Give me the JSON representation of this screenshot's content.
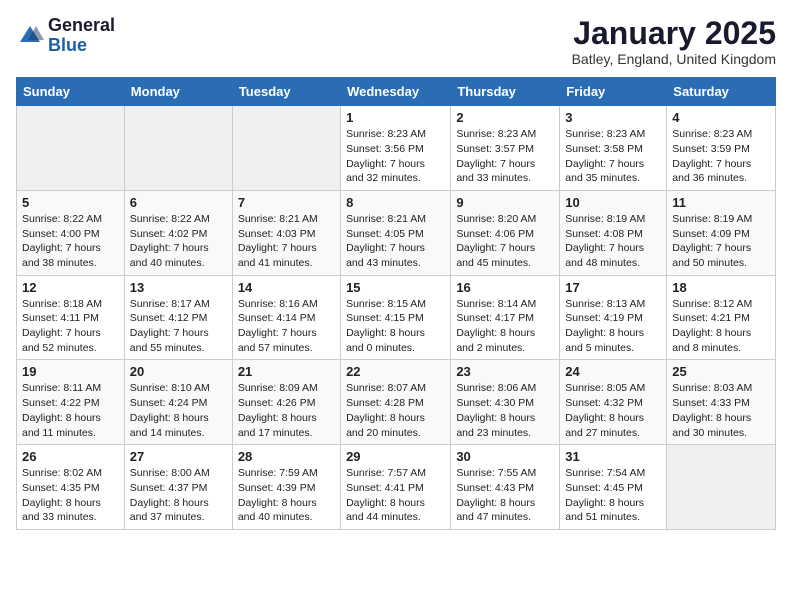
{
  "header": {
    "logo_general": "General",
    "logo_blue": "Blue",
    "title": "January 2025",
    "location": "Batley, England, United Kingdom"
  },
  "calendar": {
    "days_of_week": [
      "Sunday",
      "Monday",
      "Tuesday",
      "Wednesday",
      "Thursday",
      "Friday",
      "Saturday"
    ],
    "weeks": [
      [
        {
          "day": "",
          "info": ""
        },
        {
          "day": "",
          "info": ""
        },
        {
          "day": "",
          "info": ""
        },
        {
          "day": "1",
          "info": "Sunrise: 8:23 AM\nSunset: 3:56 PM\nDaylight: 7 hours\nand 32 minutes."
        },
        {
          "day": "2",
          "info": "Sunrise: 8:23 AM\nSunset: 3:57 PM\nDaylight: 7 hours\nand 33 minutes."
        },
        {
          "day": "3",
          "info": "Sunrise: 8:23 AM\nSunset: 3:58 PM\nDaylight: 7 hours\nand 35 minutes."
        },
        {
          "day": "4",
          "info": "Sunrise: 8:23 AM\nSunset: 3:59 PM\nDaylight: 7 hours\nand 36 minutes."
        }
      ],
      [
        {
          "day": "5",
          "info": "Sunrise: 8:22 AM\nSunset: 4:00 PM\nDaylight: 7 hours\nand 38 minutes."
        },
        {
          "day": "6",
          "info": "Sunrise: 8:22 AM\nSunset: 4:02 PM\nDaylight: 7 hours\nand 40 minutes."
        },
        {
          "day": "7",
          "info": "Sunrise: 8:21 AM\nSunset: 4:03 PM\nDaylight: 7 hours\nand 41 minutes."
        },
        {
          "day": "8",
          "info": "Sunrise: 8:21 AM\nSunset: 4:05 PM\nDaylight: 7 hours\nand 43 minutes."
        },
        {
          "day": "9",
          "info": "Sunrise: 8:20 AM\nSunset: 4:06 PM\nDaylight: 7 hours\nand 45 minutes."
        },
        {
          "day": "10",
          "info": "Sunrise: 8:19 AM\nSunset: 4:08 PM\nDaylight: 7 hours\nand 48 minutes."
        },
        {
          "day": "11",
          "info": "Sunrise: 8:19 AM\nSunset: 4:09 PM\nDaylight: 7 hours\nand 50 minutes."
        }
      ],
      [
        {
          "day": "12",
          "info": "Sunrise: 8:18 AM\nSunset: 4:11 PM\nDaylight: 7 hours\nand 52 minutes."
        },
        {
          "day": "13",
          "info": "Sunrise: 8:17 AM\nSunset: 4:12 PM\nDaylight: 7 hours\nand 55 minutes."
        },
        {
          "day": "14",
          "info": "Sunrise: 8:16 AM\nSunset: 4:14 PM\nDaylight: 7 hours\nand 57 minutes."
        },
        {
          "day": "15",
          "info": "Sunrise: 8:15 AM\nSunset: 4:15 PM\nDaylight: 8 hours\nand 0 minutes."
        },
        {
          "day": "16",
          "info": "Sunrise: 8:14 AM\nSunset: 4:17 PM\nDaylight: 8 hours\nand 2 minutes."
        },
        {
          "day": "17",
          "info": "Sunrise: 8:13 AM\nSunset: 4:19 PM\nDaylight: 8 hours\nand 5 minutes."
        },
        {
          "day": "18",
          "info": "Sunrise: 8:12 AM\nSunset: 4:21 PM\nDaylight: 8 hours\nand 8 minutes."
        }
      ],
      [
        {
          "day": "19",
          "info": "Sunrise: 8:11 AM\nSunset: 4:22 PM\nDaylight: 8 hours\nand 11 minutes."
        },
        {
          "day": "20",
          "info": "Sunrise: 8:10 AM\nSunset: 4:24 PM\nDaylight: 8 hours\nand 14 minutes."
        },
        {
          "day": "21",
          "info": "Sunrise: 8:09 AM\nSunset: 4:26 PM\nDaylight: 8 hours\nand 17 minutes."
        },
        {
          "day": "22",
          "info": "Sunrise: 8:07 AM\nSunset: 4:28 PM\nDaylight: 8 hours\nand 20 minutes."
        },
        {
          "day": "23",
          "info": "Sunrise: 8:06 AM\nSunset: 4:30 PM\nDaylight: 8 hours\nand 23 minutes."
        },
        {
          "day": "24",
          "info": "Sunrise: 8:05 AM\nSunset: 4:32 PM\nDaylight: 8 hours\nand 27 minutes."
        },
        {
          "day": "25",
          "info": "Sunrise: 8:03 AM\nSunset: 4:33 PM\nDaylight: 8 hours\nand 30 minutes."
        }
      ],
      [
        {
          "day": "26",
          "info": "Sunrise: 8:02 AM\nSunset: 4:35 PM\nDaylight: 8 hours\nand 33 minutes."
        },
        {
          "day": "27",
          "info": "Sunrise: 8:00 AM\nSunset: 4:37 PM\nDaylight: 8 hours\nand 37 minutes."
        },
        {
          "day": "28",
          "info": "Sunrise: 7:59 AM\nSunset: 4:39 PM\nDaylight: 8 hours\nand 40 minutes."
        },
        {
          "day": "29",
          "info": "Sunrise: 7:57 AM\nSunset: 4:41 PM\nDaylight: 8 hours\nand 44 minutes."
        },
        {
          "day": "30",
          "info": "Sunrise: 7:55 AM\nSunset: 4:43 PM\nDaylight: 8 hours\nand 47 minutes."
        },
        {
          "day": "31",
          "info": "Sunrise: 7:54 AM\nSunset: 4:45 PM\nDaylight: 8 hours\nand 51 minutes."
        },
        {
          "day": "",
          "info": ""
        }
      ]
    ]
  }
}
